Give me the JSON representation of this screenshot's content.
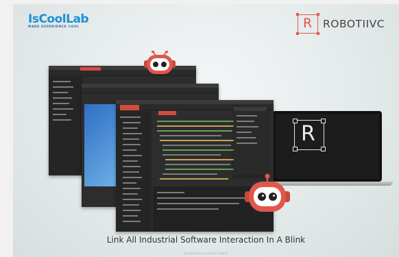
{
  "left_logo": {
    "name": "IsCoolLab",
    "tagline": "MAKE EXPERIENCE COOL",
    "color": "#1e8fd6"
  },
  "right_logo": {
    "glyph": "R",
    "name": "ROBOTIIVC",
    "color": "#e0584b"
  },
  "laptop_logo": {
    "glyph": "R"
  },
  "tagline": "Link All Industrial Software Interaction In A Blink",
  "credit": "Designed by iscoolnav | Freepik",
  "colors": {
    "accent": "#d24b3e",
    "ide_bg": "#2d2d2d",
    "robot_red": "#e0584b"
  }
}
